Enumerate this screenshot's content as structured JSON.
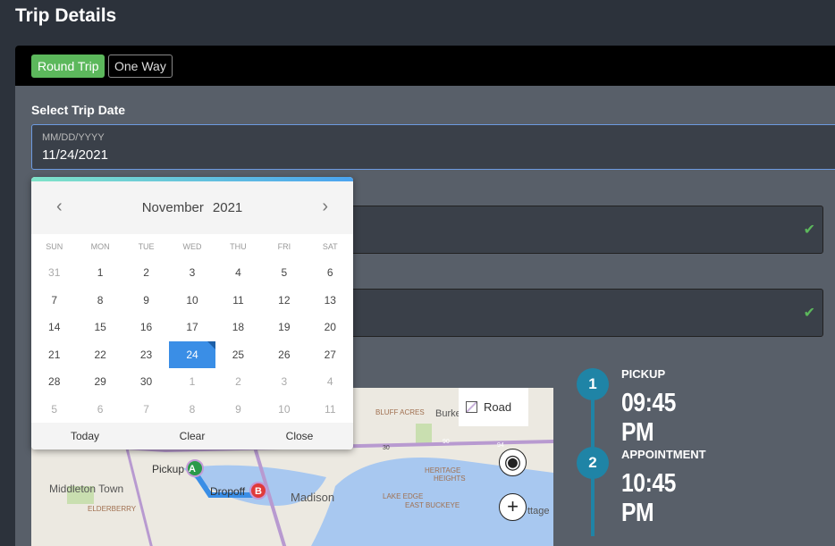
{
  "page": {
    "title": "Trip Details"
  },
  "tabs": [
    {
      "label": "Round Trip",
      "active": true
    },
    {
      "label": "One Way",
      "active": false
    }
  ],
  "date": {
    "label": "Select Trip Date",
    "placeholder": "MM/DD/YYYY",
    "value": "11/24/2021"
  },
  "calendar": {
    "month": "November",
    "year": "2021",
    "prev_icon": "chevron-left",
    "next_icon": "chevron-right",
    "dows": [
      "SUN",
      "MON",
      "TUE",
      "WED",
      "THU",
      "FRI",
      "SAT"
    ],
    "days": [
      [
        "31",
        1
      ],
      [
        "1",
        0
      ],
      [
        "2",
        0
      ],
      [
        "3",
        0
      ],
      [
        "4",
        0
      ],
      [
        "5",
        0
      ],
      [
        "6",
        0
      ],
      [
        "7",
        0
      ],
      [
        "8",
        0
      ],
      [
        "9",
        0
      ],
      [
        "10",
        0
      ],
      [
        "11",
        0
      ],
      [
        "12",
        0
      ],
      [
        "13",
        0
      ],
      [
        "14",
        0
      ],
      [
        "15",
        0
      ],
      [
        "16",
        0
      ],
      [
        "17",
        0
      ],
      [
        "18",
        0
      ],
      [
        "19",
        0
      ],
      [
        "20",
        0
      ],
      [
        "21",
        0
      ],
      [
        "22",
        0
      ],
      [
        "23",
        0
      ],
      [
        "24",
        2
      ],
      [
        "25",
        0
      ],
      [
        "26",
        0
      ],
      [
        "27",
        0
      ],
      [
        "28",
        0
      ],
      [
        "29",
        0
      ],
      [
        "30",
        0
      ],
      [
        "1",
        1
      ],
      [
        "2",
        1
      ],
      [
        "3",
        1
      ],
      [
        "4",
        1
      ],
      [
        "5",
        1
      ],
      [
        "6",
        1
      ],
      [
        "7",
        1
      ],
      [
        "8",
        1
      ],
      [
        "9",
        1
      ],
      [
        "10",
        1
      ],
      [
        "11",
        1
      ]
    ],
    "footer": [
      "Today",
      "Clear",
      "Close"
    ]
  },
  "map": {
    "style_label": "Road",
    "labels": {
      "pickup": "Pickup",
      "dropoff": "Dropoff",
      "a": "A",
      "b": "B",
      "middleton": "Middleton Town",
      "elderberry": "ELDERBERRY",
      "madison": "Madison",
      "bluff": "BLUFF ACRES",
      "burke": "Burke",
      "heritage": "HERITAGE",
      "heights": "HEIGHTS",
      "lake_edge": "LAKE EDGE",
      "east_buckeye": "EAST BUCKEYE",
      "cottage": "ttage",
      "r30": "30",
      "r90": "90",
      "r94": "94"
    }
  },
  "timeline": [
    {
      "num": "1",
      "label": "PICKUP",
      "time": "09:45 PM"
    },
    {
      "num": "2",
      "label": "APPOINTMENT",
      "time": "10:45 PM"
    }
  ],
  "colors": {
    "accent": "#5cb85c",
    "timeline": "#1f84a6",
    "selected_day": "#3a8ee6"
  }
}
